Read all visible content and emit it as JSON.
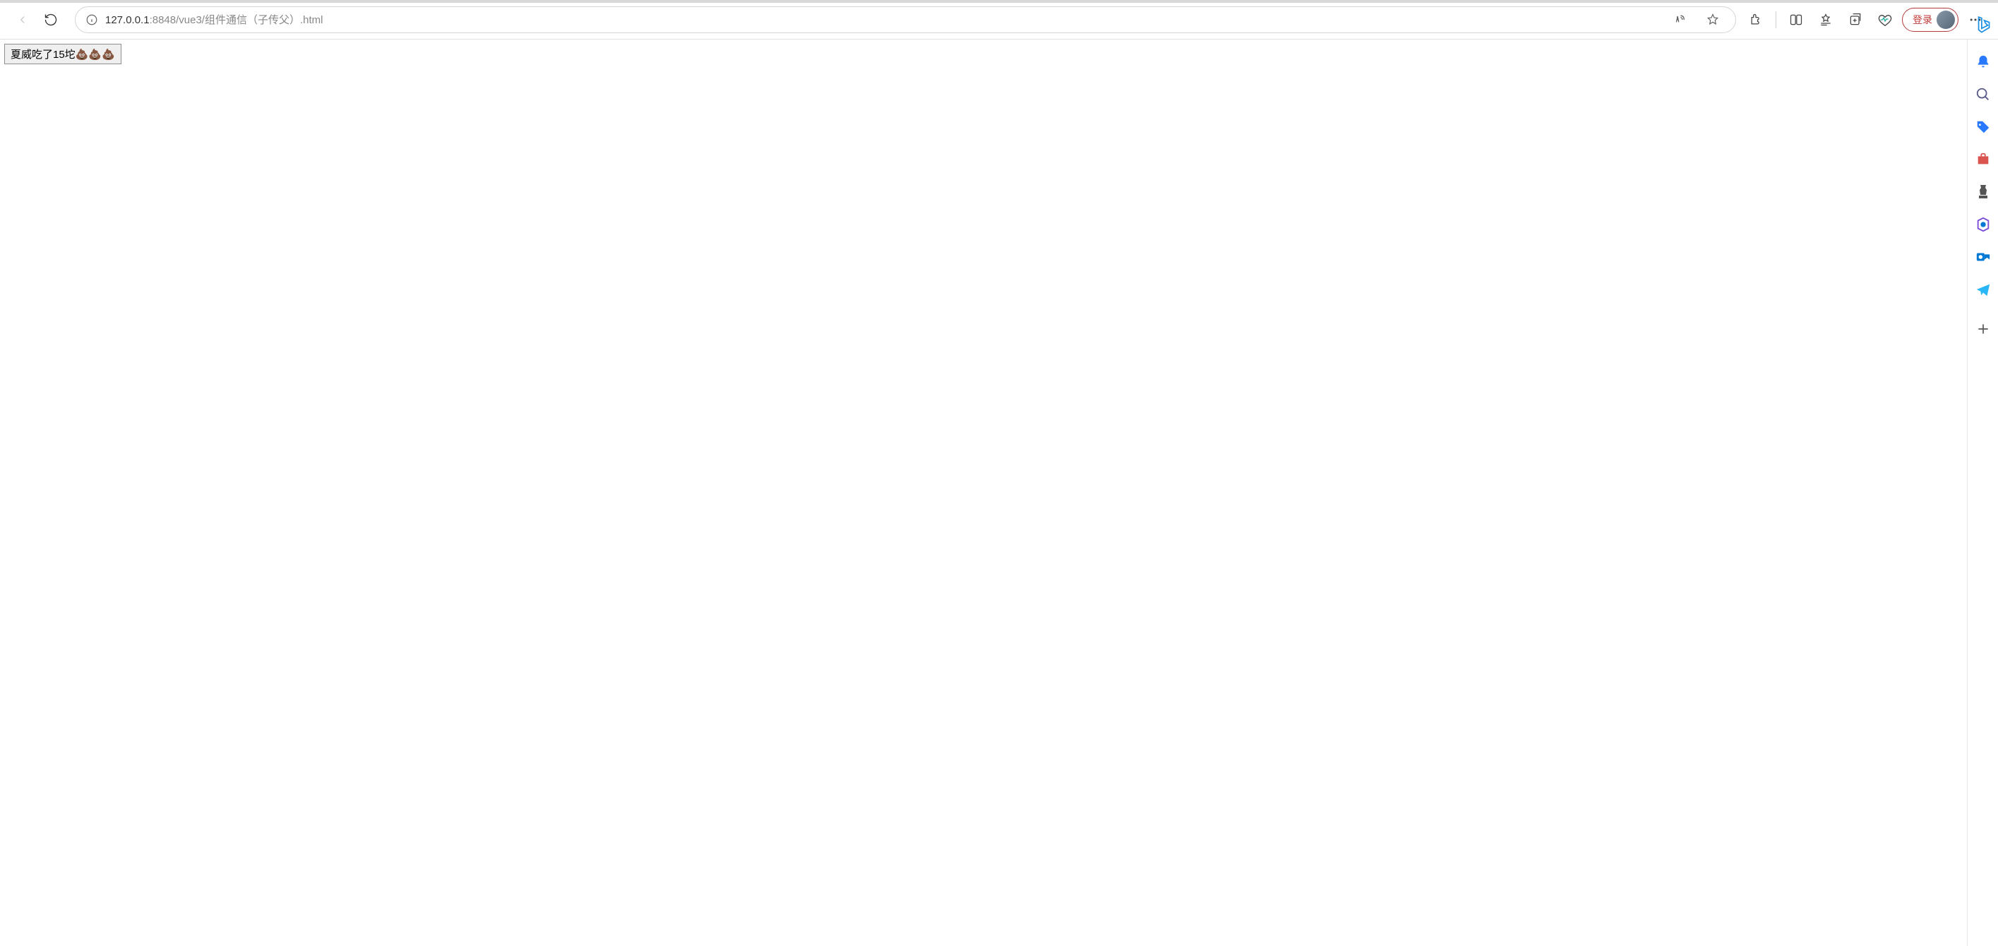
{
  "browser": {
    "url_host": "127.0.0.1",
    "url_port": ":8848",
    "url_path": "/vue3/组件通信（子传父）.html",
    "login_label": "登录"
  },
  "page": {
    "button_text": "夏威吃了15坨💩💩💩"
  }
}
